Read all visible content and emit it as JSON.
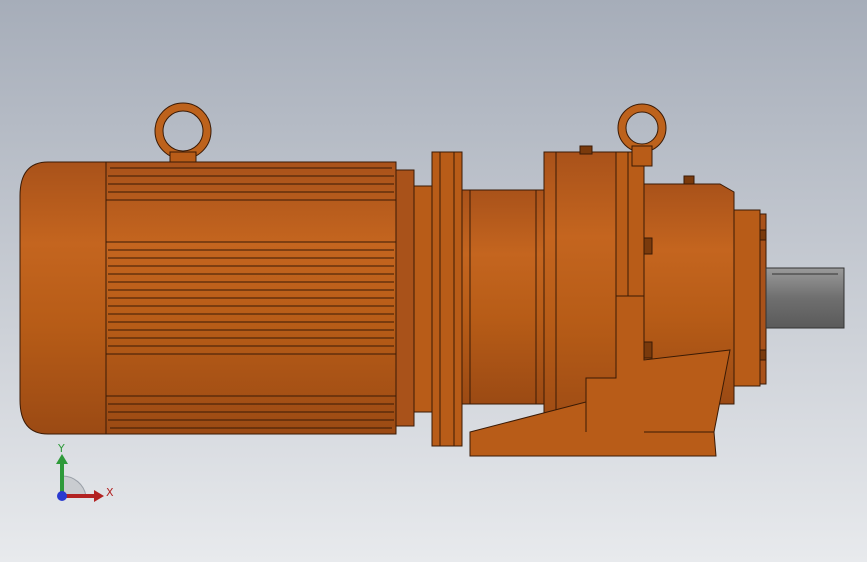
{
  "viewport": {
    "background_top": "#a6adb9",
    "background_bottom": "#e8eaed",
    "model_color": "#b85c18",
    "model_dark": "#7a3a0c",
    "model_light": "#cf7430",
    "shaft_color": "#7d7d7d"
  },
  "triad": {
    "x_label": "X",
    "y_label": "Y",
    "x_color": "#b22222",
    "y_color": "#2e9a3a",
    "z_color": "#2a3ad0"
  }
}
